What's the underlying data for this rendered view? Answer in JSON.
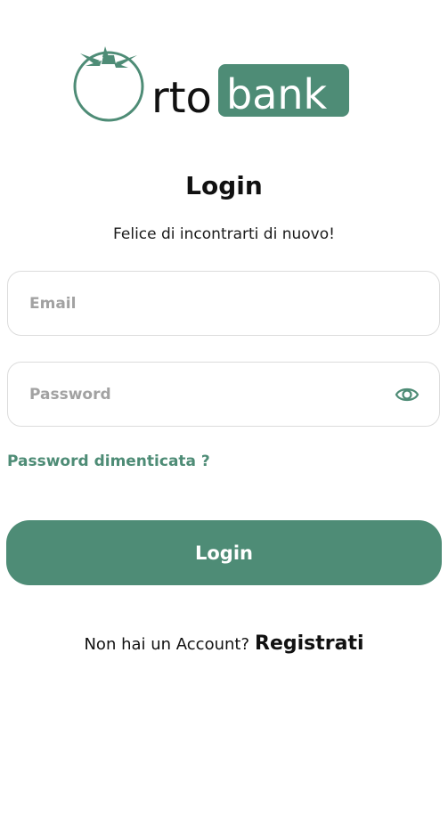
{
  "brand": {
    "logo_text_left": "rto",
    "logo_text_right": "bank",
    "accent_color": "#4e8c76"
  },
  "header": {
    "title": "Login",
    "subtitle": "Felice di incontrarti di nuovo!"
  },
  "form": {
    "email_placeholder": "Email",
    "email_value": "",
    "password_placeholder": "Password",
    "password_value": "",
    "password_toggle_icon": "eye-icon",
    "forgot_password_label": "Password dimenticata ?",
    "login_button_label": "Login"
  },
  "footer": {
    "register_prompt": "Non hai un Account?",
    "register_link": "Registrati"
  }
}
